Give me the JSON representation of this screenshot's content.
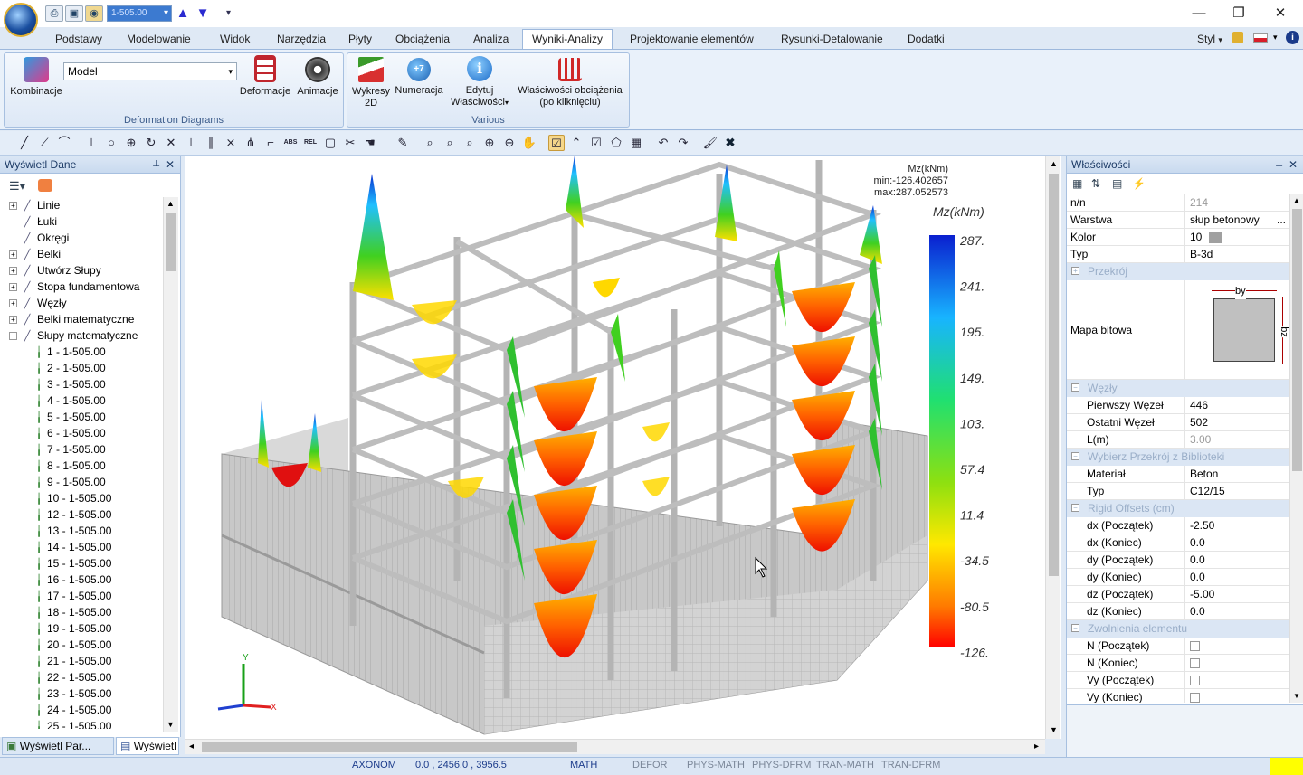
{
  "quick_access": {
    "combo_value": "1-505.00"
  },
  "window": {
    "minimize": "—",
    "maximize": "❐",
    "close": "✕"
  },
  "tabs": [
    "Podstawy",
    "Modelowanie",
    "Widok",
    "Narzędzia",
    "Płyty",
    "Obciążenia",
    "Analiza",
    "Wyniki-Analizy",
    "Projektowanie elementów",
    "Rysunki-Detalowanie",
    "Dodatki"
  ],
  "tabs_right": {
    "style": "Styl"
  },
  "ribbon": {
    "deformation_group": {
      "label": "Deformation Diagrams",
      "kombinacje": "Kombinacje",
      "model_select": "Model",
      "deformacje": "Deformacje",
      "animacje": "Animacje"
    },
    "various_group": {
      "label": "Various",
      "wykresy": "Wykresy",
      "wykresy_sub": "2D",
      "numeracja": "Numeracja",
      "edytuj": "Edytuj",
      "edytuj_sub": "Właściwości",
      "wlasciwosci": "Właściwości obciążenia",
      "wlasciwosci_sub": "(po kliknięciu)"
    }
  },
  "left_panel": {
    "title": "Wyświetl Dane",
    "tree": [
      {
        "label": "Linie",
        "expander": "+"
      },
      {
        "label": "Łuki",
        "expander": ""
      },
      {
        "label": "Okręgi",
        "expander": ""
      },
      {
        "label": "Belki",
        "expander": "+"
      },
      {
        "label": "Utwórz Słupy",
        "expander": "+"
      },
      {
        "label": "Stopa fundamentowa",
        "expander": "+"
      },
      {
        "label": "Węzły",
        "expander": "+"
      },
      {
        "label": "Belki matematyczne",
        "expander": "+"
      },
      {
        "label": "Słupy matematyczne",
        "expander": "−"
      }
    ],
    "columns": [
      "1 - 1-505.00",
      "2 - 1-505.00",
      "3 - 1-505.00",
      "4 - 1-505.00",
      "5 - 1-505.00",
      "6 - 1-505.00",
      "7 - 1-505.00",
      "8 - 1-505.00",
      "9 - 1-505.00",
      "10 - 1-505.00",
      "12 - 1-505.00",
      "13 - 1-505.00",
      "14 - 1-505.00",
      "15 - 1-505.00",
      "16 - 1-505.00",
      "17 - 1-505.00",
      "18 - 1-505.00",
      "19 - 1-505.00",
      "20 - 1-505.00",
      "21 - 1-505.00",
      "22 - 1-505.00",
      "23 - 1-505.00",
      "24 - 1-505.00",
      "25 - 1-505.00"
    ],
    "bottom_tabs": [
      "Wyświetl Par...",
      "Wyświetl Da..."
    ]
  },
  "viewport": {
    "info_title": "Mz(kNm)",
    "info_min": "min:-126.402657",
    "info_max": "max:287.052573",
    "legend_title": "Mz(kNm)",
    "legend_values": [
      "287.",
      "241.",
      "195.",
      "149.",
      "103.",
      "57.4",
      "11.4",
      "-34.5",
      "-80.5",
      "-126."
    ],
    "axis_x": "X",
    "axis_y": "Y"
  },
  "right_panel": {
    "title": "Właściwości",
    "rows_top": [
      {
        "name": "n/n",
        "value": "214",
        "grey": true
      },
      {
        "name": "Warstwa",
        "value": "słup betonowy",
        "extra": "..."
      },
      {
        "name": "Kolor",
        "value": "10",
        "swatch": "#a0a0a0"
      },
      {
        "name": "Typ",
        "value": "B-3d"
      }
    ],
    "cat_przekroj": "Przekrój",
    "bitmap": {
      "name": "Mapa bitowa",
      "by": "by",
      "bz": "bz"
    },
    "cat_wezly": "Węzły",
    "rows_wezly": [
      {
        "name": "Pierwszy Węzeł",
        "value": "446"
      },
      {
        "name": "Ostatni Węzeł",
        "value": "502"
      },
      {
        "name": "L(m)",
        "value": "3.00",
        "grey": true
      }
    ],
    "cat_biblioteka": "Wybierz Przekrój z Biblioteki",
    "rows_biblioteka": [
      {
        "name": "Materiał",
        "value": "Beton"
      },
      {
        "name": "Typ",
        "value": "C12/15"
      }
    ],
    "cat_rigid": "Rigid Offsets (cm)",
    "rows_rigid": [
      {
        "name": "dx (Początek)",
        "value": "-2.50"
      },
      {
        "name": "dx (Koniec)",
        "value": "0.0"
      },
      {
        "name": "dy (Początek)",
        "value": "0.0"
      },
      {
        "name": "dy (Koniec)",
        "value": "0.0"
      },
      {
        "name": "dz (Początek)",
        "value": "-5.00"
      },
      {
        "name": "dz (Koniec)",
        "value": "0.0"
      }
    ],
    "cat_zwolnienia": "Zwolnienia elementu",
    "rows_zwolnienia": [
      {
        "name": "N (Początek)"
      },
      {
        "name": "N (Koniec)"
      },
      {
        "name": "Vy (Początek)"
      },
      {
        "name": "Vy (Koniec)"
      }
    ]
  },
  "status": {
    "mode": "AXONOM",
    "coords": "0.0 , 2456.0 , 3956.5",
    "math": "MATH",
    "defor": "DEFOR",
    "phys_math": "PHYS-MATH",
    "phys_dfrm": "PHYS-DFRM",
    "tran_math": "TRAN-MATH",
    "tran_dfrm": "TRAN-DFRM"
  }
}
